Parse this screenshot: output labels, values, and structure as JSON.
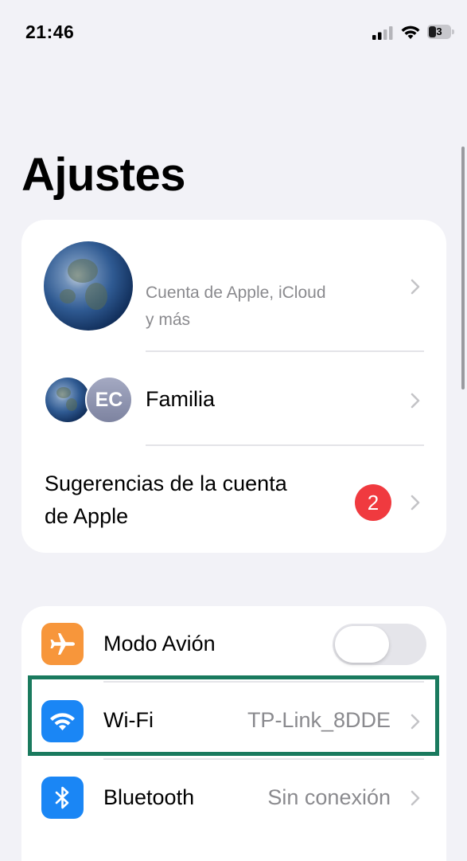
{
  "status_bar": {
    "time": "21:46",
    "battery_level": "3",
    "icons": [
      "cellular-signal-icon",
      "wifi-icon",
      "battery-icon"
    ]
  },
  "page": {
    "title": "Ajustes"
  },
  "account_section": {
    "account_row": {
      "subtitle_line1": "Cuenta de Apple, iCloud",
      "subtitle_line2": "y más",
      "icon": "chevron-right-icon"
    },
    "family_row": {
      "avatar_initials": "EC",
      "label": "Familia",
      "icon": "chevron-right-icon"
    },
    "suggestions_row": {
      "label_line1": "Sugerencias de la cuenta",
      "label_line2": "de Apple",
      "badge": "2",
      "icon": "chevron-right-icon"
    }
  },
  "connectivity_section": {
    "airplane": {
      "label": "Modo Avión",
      "icon": "airplane-icon",
      "toggle_on": false
    },
    "wifi": {
      "label": "Wi-Fi",
      "value": "TP-Link_8DDE",
      "icon": "wifi-icon"
    },
    "bluetooth": {
      "label": "Bluetooth",
      "value": "Sin conexión",
      "icon": "bluetooth-icon"
    }
  },
  "colors": {
    "background": "#f2f2f7",
    "card": "#ffffff",
    "airplane_icon_bg": "#f7963b",
    "wifi_icon_bg": "#1a86f5",
    "bluetooth_icon_bg": "#1a86f5",
    "badge": "#f03a3f",
    "highlight_border": "#1a7a5e",
    "secondary_text": "#8a8a8e"
  }
}
